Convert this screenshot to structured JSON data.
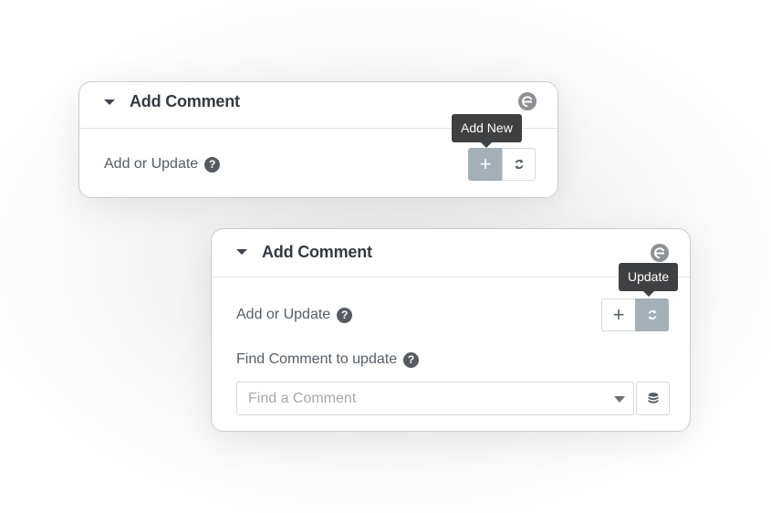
{
  "panels": [
    {
      "title": "Add Comment",
      "field_label": "Add or Update",
      "help_glyph": "?",
      "buttons": [
        {
          "name": "add-new",
          "icon": "plus-icon",
          "glyph": "+",
          "active": true
        },
        {
          "name": "update",
          "icon": "refresh-icon",
          "active": false
        }
      ],
      "tooltip": "Add New"
    },
    {
      "title": "Add Comment",
      "field_label": "Add or Update",
      "help_glyph": "?",
      "buttons": [
        {
          "name": "add-new",
          "icon": "plus-icon",
          "glyph": "+",
          "active": false
        },
        {
          "name": "update",
          "icon": "refresh-icon",
          "active": true
        }
      ],
      "tooltip": "Update",
      "find_label": "Find Comment to update",
      "find_placeholder": "Find a Comment",
      "dynamic_icon": "database-icon"
    }
  ],
  "colors": {
    "active_button": "#a4afb7",
    "tooltip_bg": "#3f4042",
    "title_text": "#343a40",
    "label_text": "#555d66"
  }
}
